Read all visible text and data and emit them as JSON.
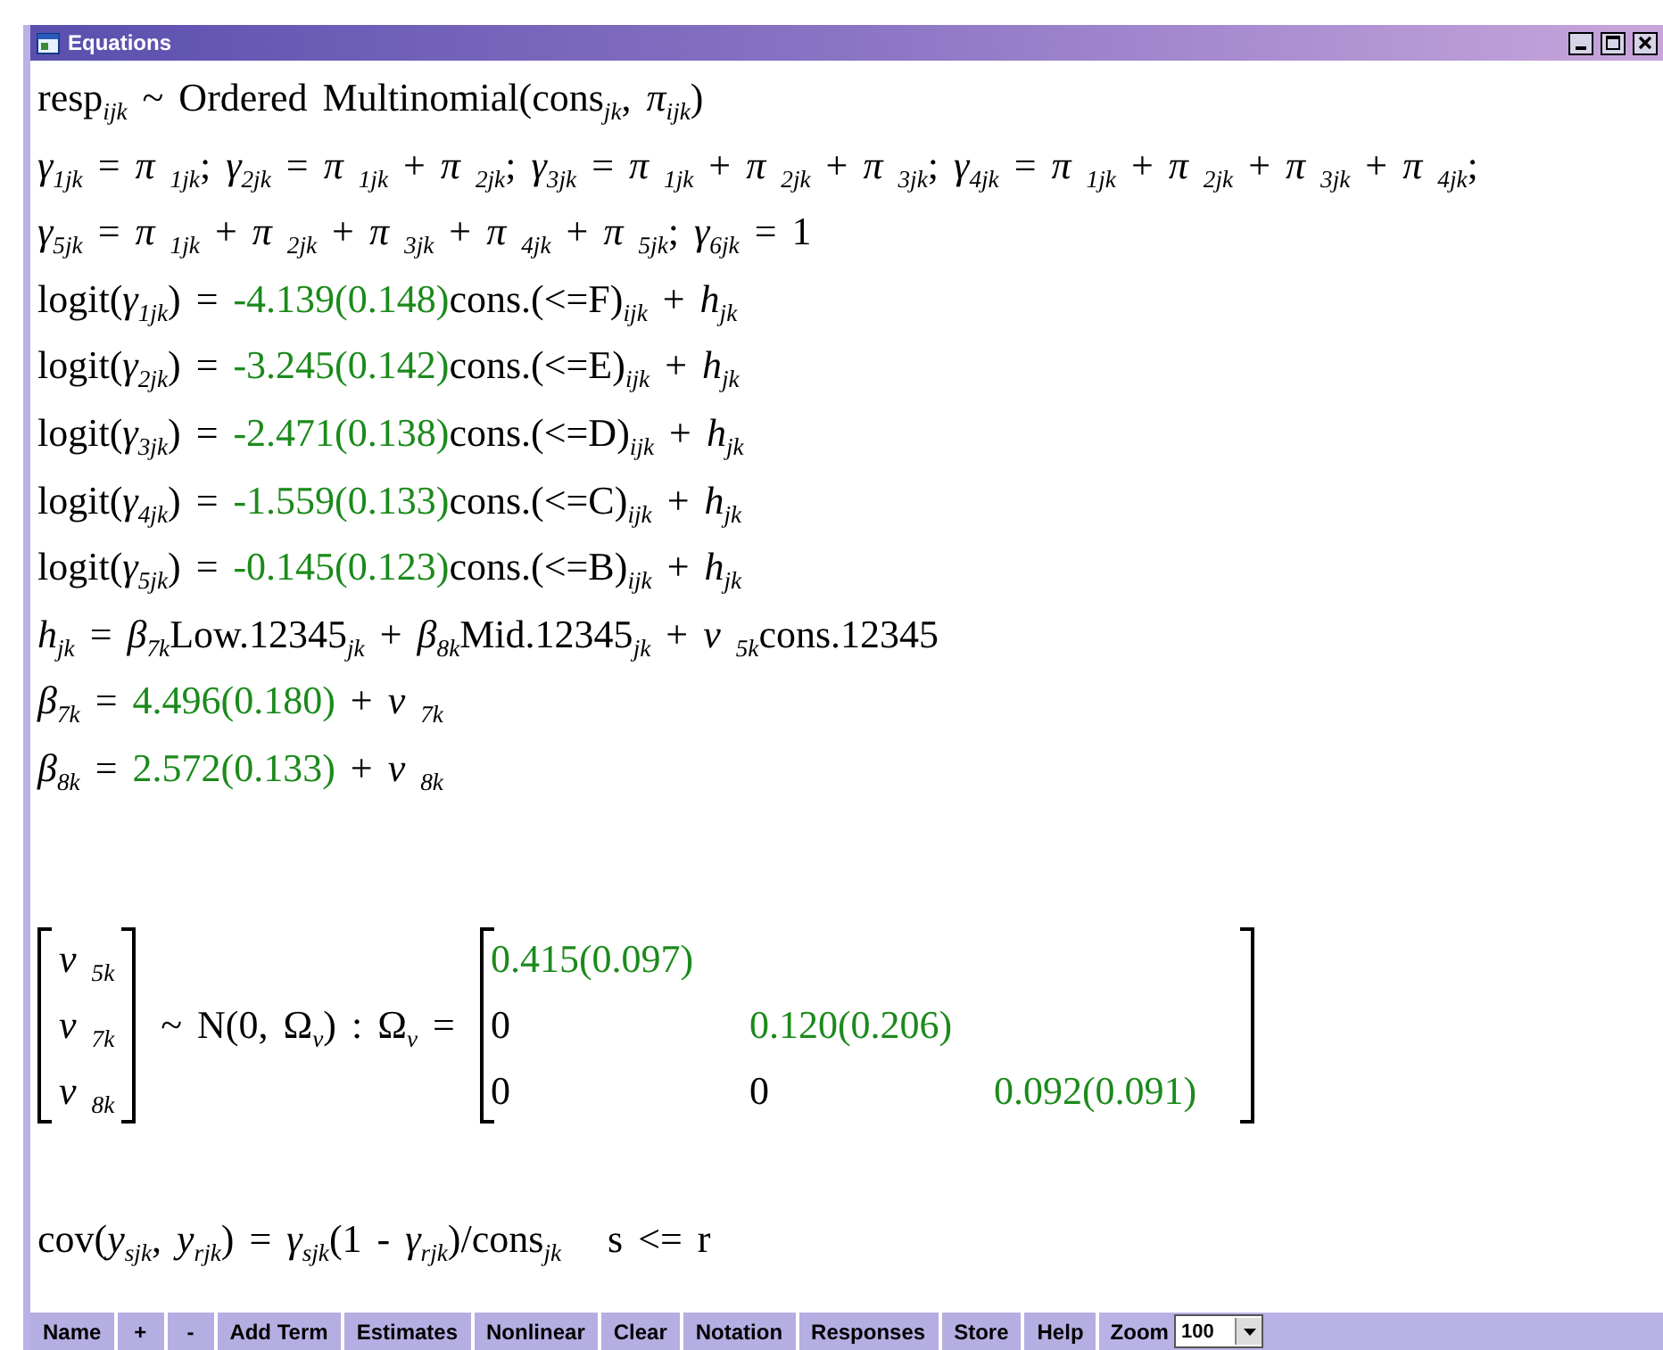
{
  "window": {
    "title": "Equations"
  },
  "equations": [
    {
      "segments": [
        {
          "kind": "text",
          "text": "resp$_{ijk}$ ~ Ordered Multinomial(cons$_{jk}$, *π*$_{ijk}$)"
        }
      ]
    },
    {
      "segments": [
        {
          "kind": "text",
          "text": "*γ*$_{1jk}$ = *π* $_{1jk}$;  *γ*$_{2jk}$ = *π* $_{1jk}$ + *π* $_{2jk}$;  *γ*$_{3jk}$ = *π* $_{1jk}$ + *π* $_{2jk}$ + *π* $_{3jk}$;  *γ*$_{4jk}$ = *π* $_{1jk}$ + *π* $_{2jk}$ + *π* $_{3jk}$ + *π* $_{4jk}$;"
        }
      ]
    },
    {
      "segments": [
        {
          "kind": "text",
          "text": "*γ*$_{5jk}$ = *π* $_{1jk}$ + *π* $_{2jk}$ + *π* $_{3jk}$ + *π* $_{4jk}$ + *π* $_{5jk}$;  *γ*$_{6jk}$ = 1"
        }
      ]
    },
    {
      "segments": [
        {
          "kind": "text",
          "text": "logit(*γ*$_{1jk}$) = "
        },
        {
          "kind": "estimate",
          "text": "-4.139(0.148)"
        },
        {
          "kind": "text",
          "text": "cons.(<=F)$_{ijk}$ + *h*$_{jk}$"
        }
      ]
    },
    {
      "segments": [
        {
          "kind": "text",
          "text": "logit(*γ*$_{2jk}$) = "
        },
        {
          "kind": "estimate",
          "text": "-3.245(0.142)"
        },
        {
          "kind": "text",
          "text": "cons.(<=E)$_{ijk}$ + *h*$_{jk}$"
        }
      ]
    },
    {
      "segments": [
        {
          "kind": "text",
          "text": "logit(*γ*$_{3jk}$) = "
        },
        {
          "kind": "estimate",
          "text": "-2.471(0.138)"
        },
        {
          "kind": "text",
          "text": "cons.(<=D)$_{ijk}$ + *h*$_{jk}$"
        }
      ]
    },
    {
      "segments": [
        {
          "kind": "text",
          "text": "logit(*γ*$_{4jk}$) = "
        },
        {
          "kind": "estimate",
          "text": "-1.559(0.133)"
        },
        {
          "kind": "text",
          "text": "cons.(<=C)$_{ijk}$ + *h*$_{jk}$"
        }
      ]
    },
    {
      "segments": [
        {
          "kind": "text",
          "text": "logit(*γ*$_{5jk}$) = "
        },
        {
          "kind": "estimate",
          "text": "-0.145(0.123)"
        },
        {
          "kind": "text",
          "text": "cons.(<=B)$_{ijk}$ + *h*$_{jk}$"
        }
      ]
    },
    {
      "segments": [
        {
          "kind": "text",
          "text": "*h*$_{jk}$ = *β*$_{7k}$Low.12345$_{jk}$ + *β*$_{8k}$Mid.12345$_{jk}$ + *v* $_{5k}$cons.12345"
        }
      ]
    },
    {
      "segments": [
        {
          "kind": "text",
          "text": "*β*$_{7k}$ = "
        },
        {
          "kind": "estimate",
          "text": "4.496(0.180)"
        },
        {
          "kind": "text",
          "text": " + *v* $_{7k}$"
        }
      ]
    },
    {
      "segments": [
        {
          "kind": "text",
          "text": "*β*$_{8k}$ = "
        },
        {
          "kind": "estimate",
          "text": "2.572(0.133)"
        },
        {
          "kind": "text",
          "text": " + *v* $_{8k}$"
        }
      ]
    }
  ],
  "distribution": {
    "vector": [
      "*v* $_{5k}$",
      "*v* $_{7k}$",
      "*v* $_{8k}$"
    ],
    "statement": "~ N(0,  Ω$_{v}$)  :  Ω$_{v}$ =",
    "matrix": [
      [
        {
          "kind": "estimate",
          "text": "0.415(0.097)"
        }
      ],
      [
        {
          "kind": "text",
          "text": "0"
        },
        {
          "kind": "estimate",
          "text": "0.120(0.206)"
        }
      ],
      [
        {
          "kind": "text",
          "text": "0"
        },
        {
          "kind": "text",
          "text": "0"
        },
        {
          "kind": "estimate",
          "text": "0.092(0.091)"
        }
      ]
    ]
  },
  "covariance": {
    "segments": [
      {
        "kind": "text",
        "text": "cov(*y*$_{sjk}$, *y*$_{rjk}$) = *γ*$_{sjk}$(1 - *γ*$_{rjk}$)/cons$_{jk}$"
      },
      {
        "kind": "text",
        "text": "s <= r"
      }
    ]
  },
  "toolbar": {
    "buttons": [
      "Name",
      "+",
      "-",
      "Add Term",
      "Estimates",
      "Nonlinear",
      "Clear",
      "Notation",
      "Responses",
      "Store",
      "Help"
    ],
    "zoom": {
      "label": "Zoom",
      "value": "100"
    }
  }
}
